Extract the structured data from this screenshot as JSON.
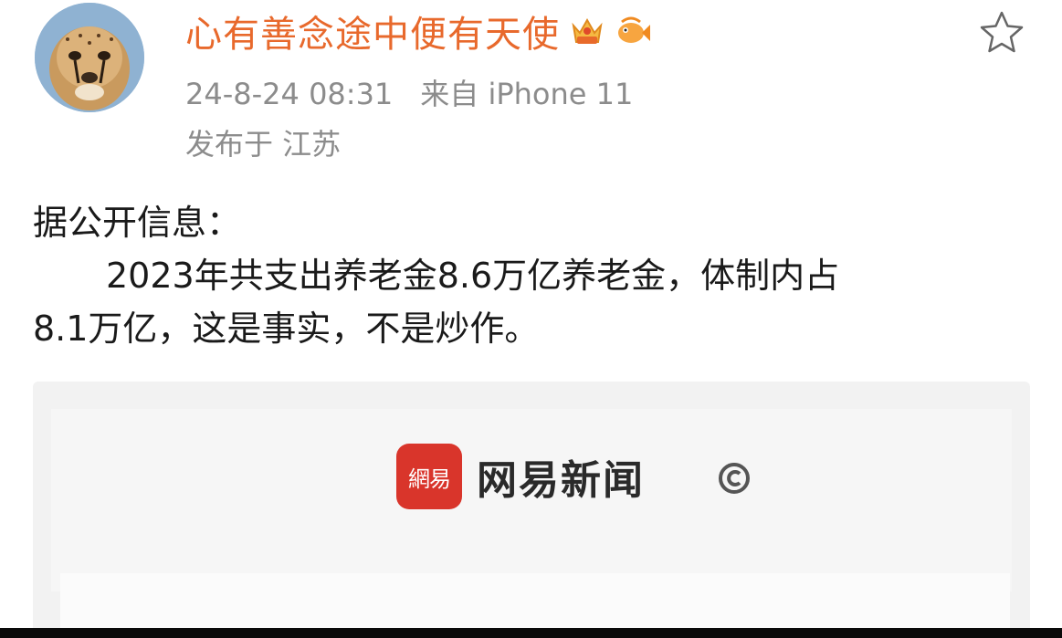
{
  "post": {
    "username": "心有善念途中便有天使",
    "timestamp": "24-8-24 08:31",
    "source": "来自 iPhone 11",
    "location": "发布于 江苏",
    "body_heading": "据公开信息：",
    "body_line1": "2023年共支出养老金8.6万亿养老金，体制内占",
    "body_line2": "8.1万亿，这是事实，不是炒作。"
  },
  "embed": {
    "brand_name": "网易新闻",
    "brand_icon_text": "網易"
  },
  "icons": {
    "avatar": "cheetah-avatar",
    "badges": [
      "vip-crown-badge",
      "fish-badge"
    ],
    "favorite": "star-outline-icon",
    "copyright": "copyright-icon"
  },
  "colors": {
    "username": "#e8692c",
    "meta_text": "#8c8c8c",
    "body_text": "#1a1a1a",
    "news_icon": "#d9352b"
  }
}
